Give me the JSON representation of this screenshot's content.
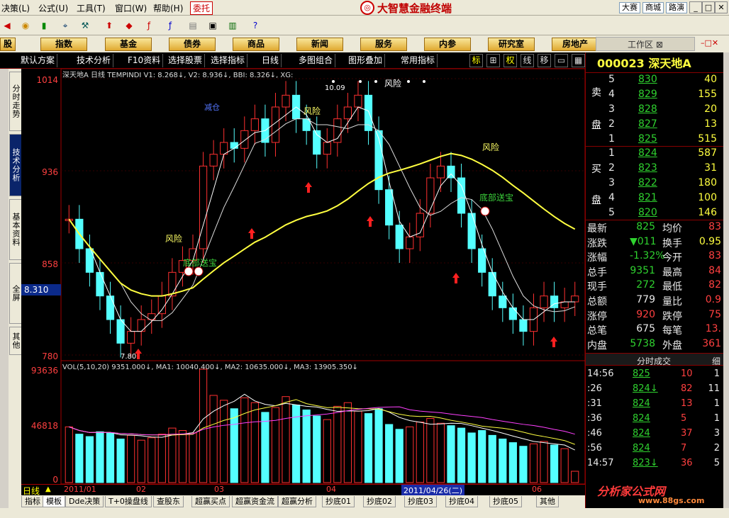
{
  "menu": {
    "items": [
      "决策(L)",
      "公式(U)",
      "工具(T)",
      "窗口(W)",
      "帮助(H)"
    ],
    "trade": "委托",
    "brand": "大智慧金融终端",
    "links": [
      "大赛",
      "商城",
      "路演"
    ]
  },
  "navbar": {
    "items": [
      "股",
      "指数",
      "基金",
      "债券",
      "商品",
      "新闻",
      "服务",
      "内参",
      "研究室",
      "房地产"
    ],
    "workarea": "工作区"
  },
  "controls": {
    "items": [
      "默认方案",
      "技术分析",
      "F10资料",
      "选择股票",
      "选择指标",
      "日线",
      "多图组合",
      "图形叠加",
      "常用指标"
    ],
    "icons": [
      "标",
      "⊞",
      "权",
      "线",
      "移"
    ]
  },
  "sidetabs": [
    "分时走势",
    "技术分析",
    "基本资料",
    "全屏",
    "其他"
  ],
  "chart": {
    "header": "深天地A 日线 TEMPINDI V1: 8.268↓, V2: 8.936↓, BBI: 8.326↓, XG:",
    "price_ticks": [
      "1014",
      "936",
      "858",
      "780"
    ],
    "current_price": "8.310",
    "high_label": "10.09",
    "low_label": "7.80",
    "annotations": [
      "减仓",
      "风险",
      "风险",
      "风险",
      "风险",
      "风险",
      "底部送宝",
      "底部送宝"
    ],
    "vol_header": "VOL(5,10,20) 9351.000↓, MA1: 10040.400↓, MA2: 10635.000↓, MA3: 13905.350↓",
    "vol_ticks": [
      "93636",
      "46818",
      "0"
    ],
    "timeline": {
      "period": "日线",
      "months": [
        "2011/01",
        "02",
        "03",
        "04",
        "2011/04/26(二)",
        "06"
      ]
    }
  },
  "chart_data": {
    "type": "candlestick",
    "series": [
      {
        "name": "TEMPINDI",
        "values": [
          8.95,
          8.7,
          8.5,
          8.3,
          8.1,
          7.9,
          8.0,
          8.1,
          8.15,
          8.3,
          8.5,
          8.6,
          8.7,
          9.4,
          9.5,
          9.6,
          9.55,
          9.7,
          9.8,
          9.6,
          9.9,
          10.0,
          9.8,
          9.7,
          9.5,
          9.6,
          9.8,
          9.9,
          10.0,
          9.7,
          9.2,
          8.9,
          8.7,
          8.8,
          9.0,
          9.3,
          9.4,
          9.3,
          9.0,
          8.7,
          8.5,
          8.3,
          8.2,
          8.1,
          8.0,
          8.2,
          8.3,
          8.2,
          8.25,
          8.3
        ]
      }
    ],
    "volume": [
      46000,
      40000,
      38000,
      42000,
      41000,
      36000,
      39000,
      35000,
      37000,
      40000,
      45000,
      43000,
      41000,
      93636,
      72000,
      68000,
      61000,
      70000,
      66000,
      58000,
      62000,
      71000,
      64000,
      60000,
      55000,
      52000,
      63000,
      66000,
      59000,
      57000,
      61000,
      48000,
      44000,
      46000,
      50000,
      53000,
      49000,
      47000,
      45000,
      41000,
      43000,
      39000,
      36000,
      33000,
      30000,
      32000,
      34000,
      31000,
      28000,
      9351
    ],
    "ylim": [
      7.8,
      10.14
    ],
    "vol_ylim": [
      0,
      93636
    ]
  },
  "right": {
    "code": "000023 深天地A",
    "sell_label": [
      "卖",
      "盘"
    ],
    "buy_label": [
      "买",
      "盘"
    ],
    "asks": [
      {
        "n": "5",
        "p": "830",
        "v": "40"
      },
      {
        "n": "4",
        "p": "829",
        "v": "155"
      },
      {
        "n": "3",
        "p": "828",
        "v": "20"
      },
      {
        "n": "2",
        "p": "827",
        "v": "13"
      },
      {
        "n": "1",
        "p": "825",
        "v": "515"
      }
    ],
    "bids": [
      {
        "n": "1",
        "p": "824",
        "v": "587"
      },
      {
        "n": "2",
        "p": "823",
        "v": "31"
      },
      {
        "n": "3",
        "p": "822",
        "v": "180"
      },
      {
        "n": "4",
        "p": "821",
        "v": "100"
      },
      {
        "n": "5",
        "p": "820",
        "v": "146"
      }
    ],
    "stats": [
      {
        "l1": "最新",
        "v1": "825",
        "l2": "均价",
        "v2": "83"
      },
      {
        "l1": "涨跌",
        "v1": "▼011",
        "l2": "换手",
        "v2": "0.95"
      },
      {
        "l1": "涨幅",
        "v1": "-1.32%",
        "l2": "今开",
        "v2": "83"
      },
      {
        "l1": "总手",
        "v1": "9351",
        "l2": "最高",
        "v2": "84"
      },
      {
        "l1": "现手",
        "v1": "272",
        "l2": "最低",
        "v2": "82"
      },
      {
        "l1": "总额",
        "v1": "779",
        "l2": "量比",
        "v2": "0.9"
      },
      {
        "l1": "涨停",
        "v1": "920",
        "l2": "跌停",
        "v2": "75"
      },
      {
        "l1": "总笔",
        "v1": "675",
        "l2": "每笔",
        "v2": "13."
      },
      {
        "l1": "内盘",
        "v1": "5738",
        "l2": "外盘",
        "v2": "361"
      }
    ],
    "trades_title": "分时成交",
    "trades_detail": "细",
    "trades": [
      {
        "t": "14:56",
        "p": "825",
        "v": "10",
        "n": "1"
      },
      {
        "t": ":26",
        "p": "824↓",
        "v": "82",
        "n": "11"
      },
      {
        "t": ":31",
        "p": "824",
        "v": "13",
        "n": "1"
      },
      {
        "t": ":36",
        "p": "824",
        "v": "5",
        "n": "1"
      },
      {
        "t": ":46",
        "p": "824",
        "v": "37",
        "n": "3"
      },
      {
        "t": ":56",
        "p": "824",
        "v": "7",
        "n": "2"
      },
      {
        "t": "14:57",
        "p": "823↓",
        "v": "36",
        "n": "5"
      }
    ]
  },
  "bottomtabs": [
    "指标",
    "模板",
    "Dde决策",
    "T+0操盘线",
    "查股东",
    "超赢买点",
    "超赢资金流",
    "超赢分析",
    "抄底01",
    "抄底02",
    "抄底03",
    "抄底04",
    "抄底05",
    "其他"
  ],
  "watermark": "分析家公式网",
  "watermark2": "www.88gs.com"
}
